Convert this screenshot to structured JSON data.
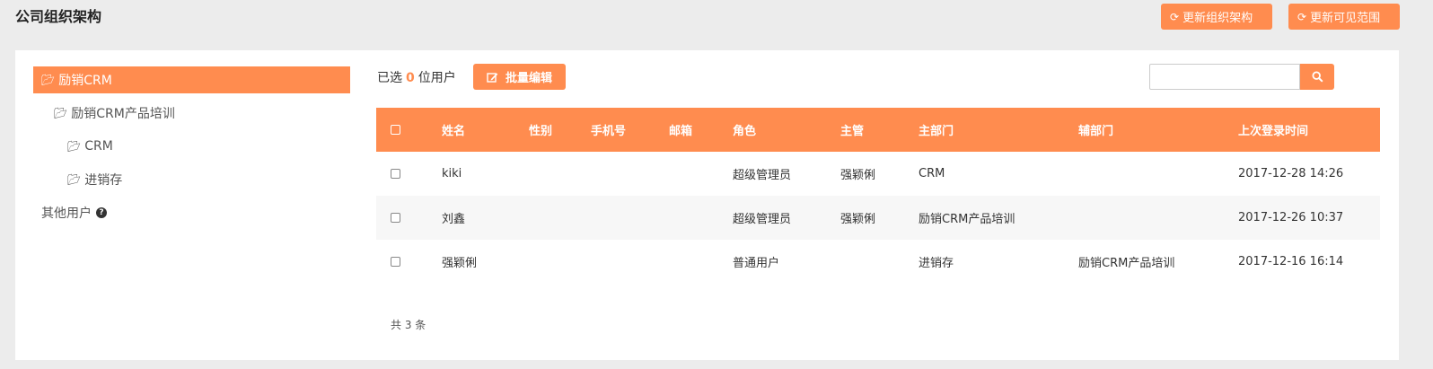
{
  "header": {
    "title": "公司组织架构",
    "btn_update_org": "更新组织架构",
    "btn_update_scope": "更新可见范围"
  },
  "tree": {
    "items": [
      {
        "label": "励销CRM"
      },
      {
        "label": "励销CRM产品培训"
      },
      {
        "label": "CRM"
      },
      {
        "label": "进销存"
      }
    ],
    "other_users": "其他用户"
  },
  "toolbar": {
    "selected_prefix": "已选",
    "selected_count": "0",
    "selected_suffix": "位用户",
    "batch_edit": "批量编辑",
    "search_placeholder": ""
  },
  "table": {
    "columns": [
      "姓名",
      "性别",
      "手机号",
      "邮箱",
      "角色",
      "主管",
      "主部门",
      "辅部门",
      "上次登录时间"
    ],
    "rows": [
      {
        "name": "kiki",
        "gender": "",
        "phone": "",
        "email": "",
        "role": "超级管理员",
        "manager": "强颖俐",
        "dept": "CRM",
        "sub_dept": "",
        "last_login": "2017-12-28 14:26"
      },
      {
        "name": "刘鑫",
        "gender": "",
        "phone": "",
        "email": "",
        "role": "超级管理员",
        "manager": "强颖俐",
        "dept": "励销CRM产品培训",
        "sub_dept": "",
        "last_login": "2017-12-26 10:37"
      },
      {
        "name": "强颖俐",
        "gender": "",
        "phone": "",
        "email": "",
        "role": "普通用户",
        "manager": "",
        "dept": "进销存",
        "sub_dept": "励销CRM产品培训",
        "last_login": "2017-12-16 16:14"
      }
    ],
    "total": "共 3 条"
  },
  "colors": {
    "accent": "#ff8c4f"
  },
  "icons": {
    "refresh": "refresh-icon",
    "folder": "folder-open-icon",
    "edit": "edit-icon",
    "search": "search-icon",
    "help": "question-circle-icon"
  }
}
